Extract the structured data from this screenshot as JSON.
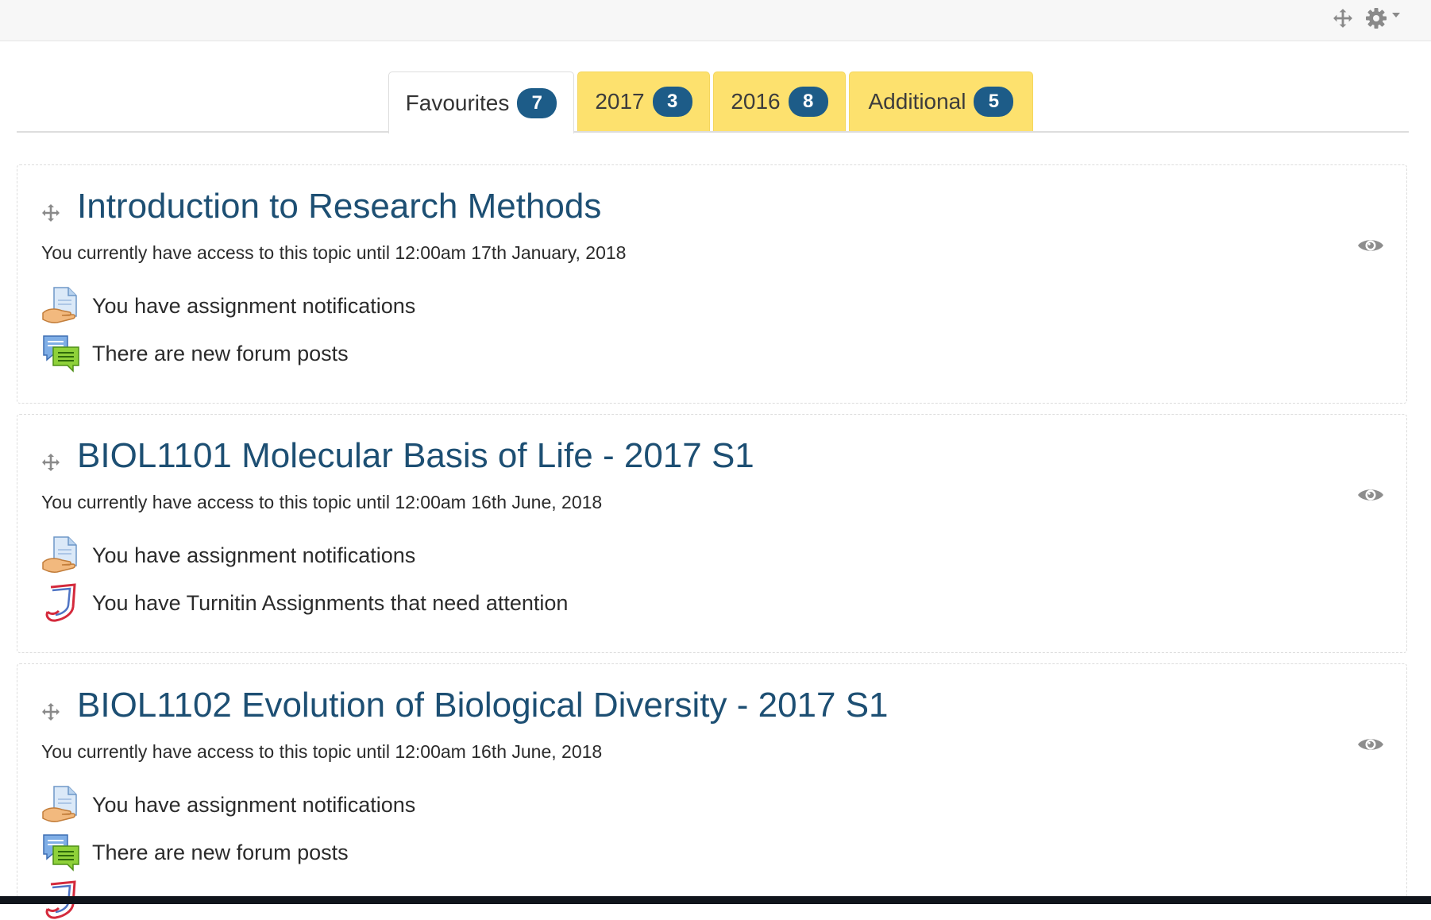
{
  "toolbar": {
    "move_icon": "move-arrows-icon",
    "settings_icon": "gear-icon"
  },
  "tabs": [
    {
      "label": "Favourites",
      "count": "7",
      "active": true
    },
    {
      "label": "2017",
      "count": "3",
      "active": false
    },
    {
      "label": "2016",
      "count": "8",
      "active": false
    },
    {
      "label": "Additional",
      "count": "5",
      "active": false
    }
  ],
  "courses": [
    {
      "title": "Introduction to Research Methods",
      "access": "You currently have access to this topic until 12:00am 17th January, 2018",
      "notifications": [
        {
          "icon": "assignment-icon",
          "text": "You have assignment notifications"
        },
        {
          "icon": "forum-icon",
          "text": "There are new forum posts"
        }
      ]
    },
    {
      "title": "BIOL1101 Molecular Basis of Life - 2017 S1",
      "access": "You currently have access to this topic until 12:00am 16th June, 2018",
      "notifications": [
        {
          "icon": "assignment-icon",
          "text": "You have assignment notifications"
        },
        {
          "icon": "turnitin-icon",
          "text": "You have Turnitin Assignments that need attention"
        }
      ]
    },
    {
      "title": "BIOL1102 Evolution of Biological Diversity - 2017 S1",
      "access": "You currently have access to this topic until 12:00am 16th June, 2018",
      "notifications": [
        {
          "icon": "assignment-icon",
          "text": "You have assignment notifications"
        },
        {
          "icon": "forum-icon",
          "text": "There are new forum posts"
        }
      ]
    }
  ],
  "colors": {
    "title": "#1d4f73",
    "badge": "#1d5c88",
    "tab_yellow": "#fde16e"
  }
}
